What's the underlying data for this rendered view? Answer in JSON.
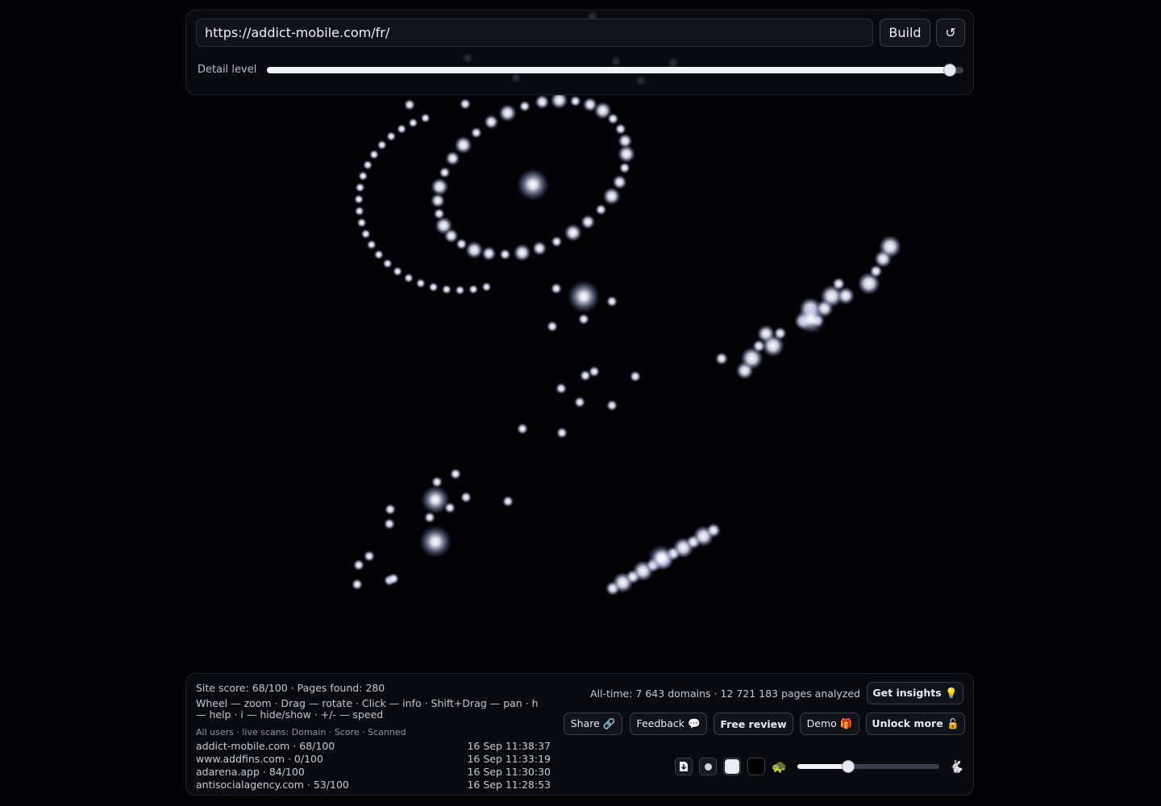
{
  "top": {
    "url_value": "https://addict-mobile.com/fr/",
    "build_label": "Build",
    "reload_icon": "↺",
    "detail_label": "Detail level",
    "detail_value": 0.98
  },
  "bottom": {
    "site_score": "Site score: 68/100 · Pages found: 280",
    "help": "Wheel — zoom · Drag — rotate · Click — info · Shift+Drag — pan · h — help · i — hide/show · +/- — speed",
    "scans_header": "All users · live scans: Domain · Score · Scanned",
    "scans": [
      {
        "domain": "addict-mobile.com · 68/100",
        "time": "16 Sep 11:38:37"
      },
      {
        "domain": "www.addfins.com · 0/100",
        "time": "16 Sep 11:33:19"
      },
      {
        "domain": "adarena.app · 84/100",
        "time": "16 Sep 11:30:30"
      },
      {
        "domain": "antisocialagency.com · 53/100",
        "time": "16 Sep 11:28:53"
      }
    ],
    "alltime": "All-time: 7 643 domains · 12 721 183 pages analyzed",
    "insights_label": "Get insights 💡",
    "share_label": "Share 🔗",
    "feedback_label": "Feedback 💬",
    "review_label": "Free review",
    "demo_label": "Demo 🎁",
    "unlock_label": "Unlock more 🔓",
    "turtle": "🐢",
    "rabbit": "🐇",
    "speed_value": 0.36
  },
  "icons": {
    "download": "download-icon",
    "small_node": "small-node-icon",
    "big_node": "big-node-icon",
    "black_bg": "dark-background-icon",
    "turtle": "turtle-icon",
    "rabbit": "rabbit-icon",
    "reload": "reload-icon"
  }
}
